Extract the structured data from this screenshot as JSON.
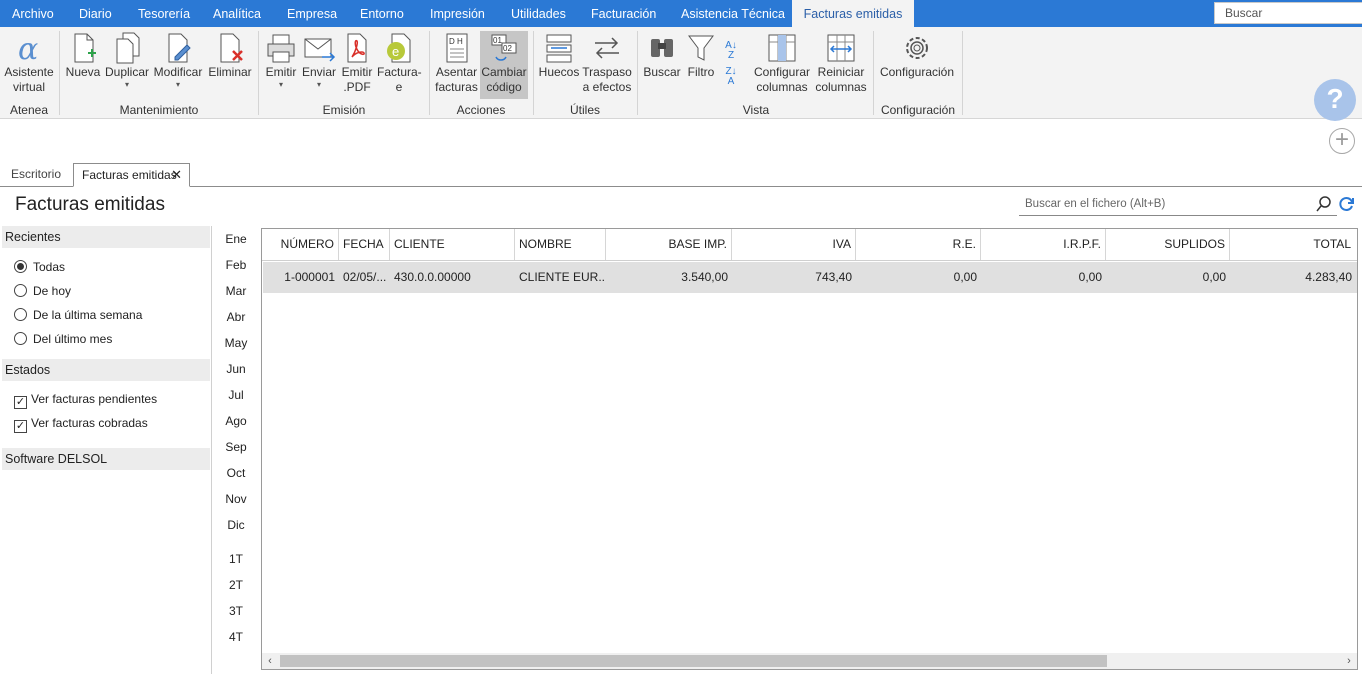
{
  "menu": {
    "items": [
      "Archivo",
      "Diario",
      "Tesorería",
      "Analítica",
      "Empresa",
      "Entorno",
      "Impresión",
      "Utilidades",
      "Facturación",
      "Asistencia Técnica",
      "Facturas emitidas"
    ],
    "search_placeholder": "Buscar"
  },
  "ribbon": {
    "buttons": {
      "asistente": "Asistente",
      "asistente2": "virtual",
      "nueva": "Nueva",
      "duplicar": "Duplicar",
      "modificar": "Modificar",
      "eliminar": "Eliminar",
      "emitir": "Emitir",
      "enviar": "Enviar",
      "emitir_pdf": "Emitir",
      ".pdf": ".PDF",
      "facturae": "Factura-",
      "facturae2": "e",
      "asentar": "Asentar",
      "asentar2": "facturas",
      "cambiar": "Cambiar",
      "cambiar2": "código",
      "huecos": "Huecos",
      "traspaso": "Traspaso",
      "traspaso2": "a efectos",
      "buscar": "Buscar",
      "filtro": "Filtro",
      "configurar": "Configurar",
      "configurar2": "columnas",
      "reiniciar": "Reiniciar",
      "reiniciar2": "columnas",
      "configuracion": "Configuración"
    },
    "groups": {
      "atenea": "Atenea",
      "mantenimiento": "Mantenimiento",
      "emision": "Emisión",
      "acciones": "Acciones",
      "utiles": "Útiles",
      "vista": "Vista",
      "configuracion": "Configuración"
    }
  },
  "tabs": {
    "escritorio": "Escritorio",
    "facturas": "Facturas emitidas"
  },
  "page_title": "Facturas emitidas",
  "file_search_placeholder": "Buscar en el fichero (Alt+B)",
  "left": {
    "recientes": "Recientes",
    "options": [
      "Todas",
      "De hoy",
      "De la última semana",
      "Del último mes"
    ],
    "estados": "Estados",
    "checks": [
      "Ver facturas pendientes",
      "Ver facturas cobradas"
    ],
    "software": "Software DELSOL"
  },
  "months": [
    "Ene",
    "Feb",
    "Mar",
    "Abr",
    "May",
    "Jun",
    "Jul",
    "Ago",
    "Sep",
    "Oct",
    "Nov",
    "Dic"
  ],
  "quarters": [
    "1T",
    "2T",
    "3T",
    "4T"
  ],
  "table": {
    "headers": [
      "NÚMERO",
      "FECHA",
      "CLIENTE",
      "NOMBRE",
      "BASE IMP.",
      "IVA",
      "R.E.",
      "I.R.P.F.",
      "SUPLIDOS",
      "TOTAL"
    ],
    "rows": [
      [
        "1-000001",
        "02/05/...",
        "430.0.0.00000",
        "CLIENTE EUR...",
        "3.540,00",
        "743,40",
        "0,00",
        "0,00",
        "0,00",
        "4.283,40"
      ]
    ]
  },
  "colors": {
    "accent": "#2b79d5",
    "ribbon_bg": "#f3f3f3",
    "selected_row": "#e0e0e0"
  }
}
